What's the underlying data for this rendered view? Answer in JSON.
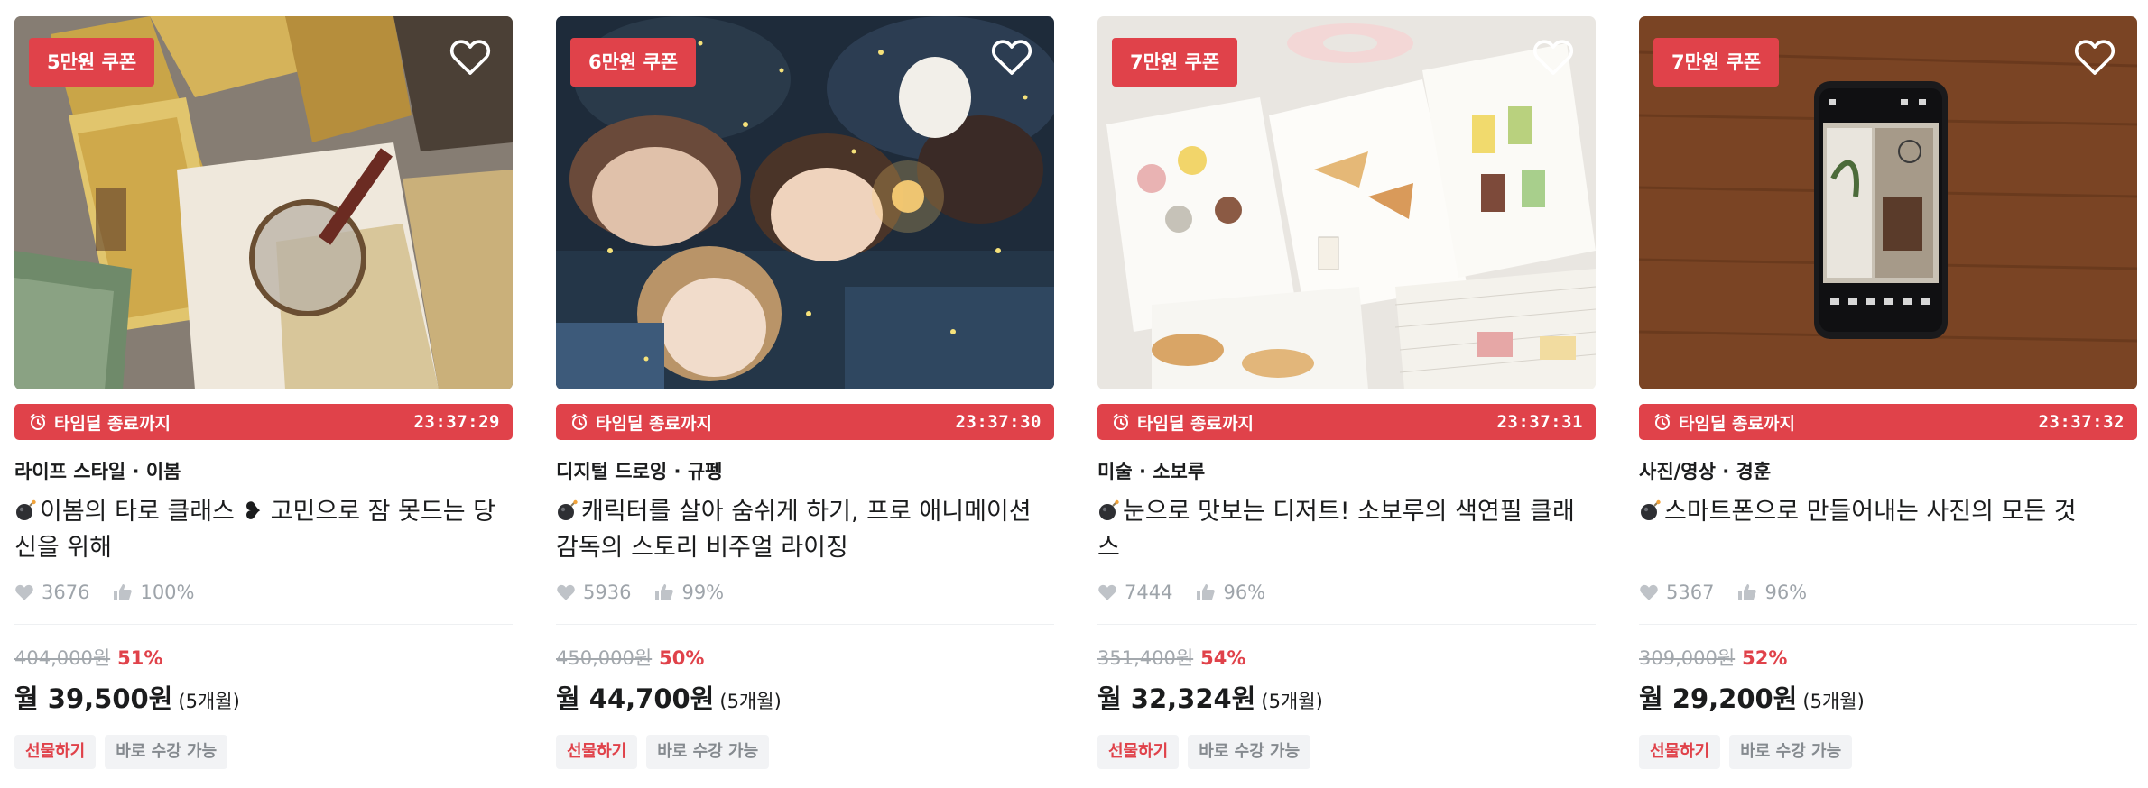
{
  "timer_label": "타임딜 종료까지",
  "months_label": "(5개월)",
  "gift_label": "선물하기",
  "instant_label": "바로 수강 가능",
  "cards": [
    {
      "coupon": "5만원 쿠폰",
      "timer": "23:37:29",
      "category": "라이프 스타일 · 이봄",
      "title": "이봄의 타로 클래스 ❥ 고민으로 잠 못드는 당신을 위해",
      "likes": "3676",
      "rating": "100%",
      "original_price": "404,000원",
      "discount": "51%",
      "monthly_price": "월 39,500원"
    },
    {
      "coupon": "6만원 쿠폰",
      "timer": "23:37:30",
      "category": "디지털 드로잉 · 규펭",
      "title": "캐릭터를 살아 숨쉬게 하기, 프로 애니메이션 감독의 스토리 비주얼 라이징",
      "likes": "5936",
      "rating": "99%",
      "original_price": "450,000원",
      "discount": "50%",
      "monthly_price": "월 44,700원"
    },
    {
      "coupon": "7만원 쿠폰",
      "timer": "23:37:31",
      "category": "미술 · 소보루",
      "title": "눈으로 맛보는 디저트! 소보루의 색연필 클래스",
      "likes": "7444",
      "rating": "96%",
      "original_price": "351,400원",
      "discount": "54%",
      "monthly_price": "월 32,324원"
    },
    {
      "coupon": "7만원 쿠폰",
      "timer": "23:37:32",
      "category": "사진/영상 · 경훈",
      "title": "스마트폰으로 만들어내는 사진의 모든 것",
      "likes": "5367",
      "rating": "96%",
      "original_price": "309,000원",
      "discount": "52%",
      "monthly_price": "월 29,200원"
    }
  ],
  "colors": {
    "accent": "#e0424a",
    "muted": "#9ea4aa",
    "text": "#1b1c1d"
  },
  "icons": [
    "heart-outline-icon",
    "alarm-clock-icon",
    "bomb-emoji-icon",
    "heart-filled-icon",
    "thumbs-up-icon"
  ]
}
